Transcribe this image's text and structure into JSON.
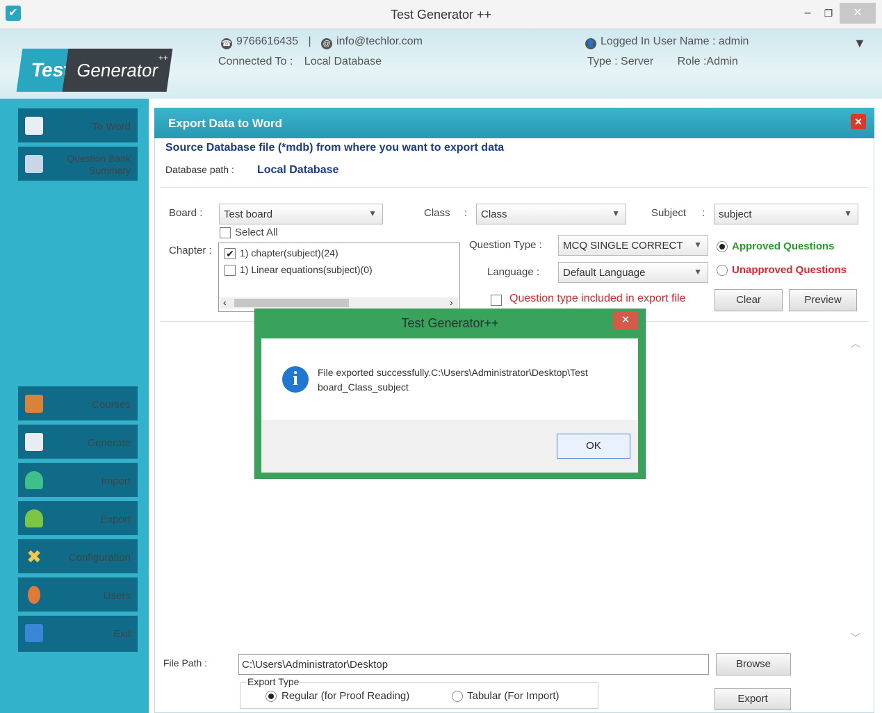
{
  "window": {
    "title": "Test Generator ++",
    "min": "–",
    "max": "❐",
    "close": "✕"
  },
  "header": {
    "logo_test": "Test",
    "logo_generator": "Generator",
    "logo_sup": "++",
    "phone": "9766616435",
    "separator": "|",
    "email": "info@techlor.com",
    "connected_label": "Connected To :",
    "connected_value": "Local Database",
    "logged_in": "Logged In User Name : admin",
    "type": "Type : Server",
    "role": "Role :Admin",
    "menu_arrow": "▼"
  },
  "sidebar": {
    "top_items": [
      {
        "label": "To Word"
      },
      {
        "label": "Question Bank Summary"
      }
    ],
    "bottom_items": [
      {
        "label": "Courses"
      },
      {
        "label": "Generate"
      },
      {
        "label": "Import"
      },
      {
        "label": "Export"
      },
      {
        "label": "Configuration"
      },
      {
        "label": "Users"
      },
      {
        "label": "Exit"
      }
    ]
  },
  "panel": {
    "title": "Export Data to Word",
    "close": "✕",
    "source_heading": "Source Database file (*mdb) from where you want to export data",
    "db_path_label": "Database path :",
    "db_path_value": "Local Database",
    "board_label": "Board :",
    "board_value": "Test board",
    "class_label": "Class",
    "class_sep": ":",
    "class_value": "Class",
    "subject_label": "Subject",
    "subject_sep": ":",
    "subject_value": "subject",
    "select_all": "Select All",
    "chapter_label": "Chapter :",
    "chapters": [
      {
        "label": "1) chapter(subject)(24)",
        "checked": "✔"
      },
      {
        "label": "1) Linear equations(subject)(0)",
        "checked": ""
      }
    ],
    "qtype_label": "Question Type  :",
    "qtype_value": "MCQ SINGLE CORRECT",
    "language_label": "Language  :",
    "language_value": "Default Language",
    "approved": "Approved Questions",
    "unapproved": "Unapproved Questions",
    "qtype_included": "Question type included in export file",
    "clear_btn": "Clear",
    "preview_btn": "Preview",
    "file_path_label": "File Path :",
    "file_path_value": "C:\\Users\\Administrator\\Desktop",
    "browse_btn": "Browse",
    "export_type_label": "Export Type",
    "regular": "Regular (for Proof Reading)",
    "tabular": "Tabular (For Import)",
    "export_btn": "Export",
    "scroll_up": "︿",
    "scroll_down": "﹀",
    "hscroll_left": "‹",
    "hscroll_right": "›"
  },
  "dialog": {
    "title": "Test Generator++",
    "close": "✕",
    "icon": "i",
    "message": "File exported successfully.C:\\Users\\Administrator\\Desktop\\Test board_Class_subject",
    "ok": "OK"
  },
  "colors": {
    "accent": "#33b3cb",
    "sidebar_item": "#0f6b88",
    "dialog_frame": "#3aa35b",
    "approved": "#2a9a2a",
    "unapproved": "#d8282a"
  }
}
